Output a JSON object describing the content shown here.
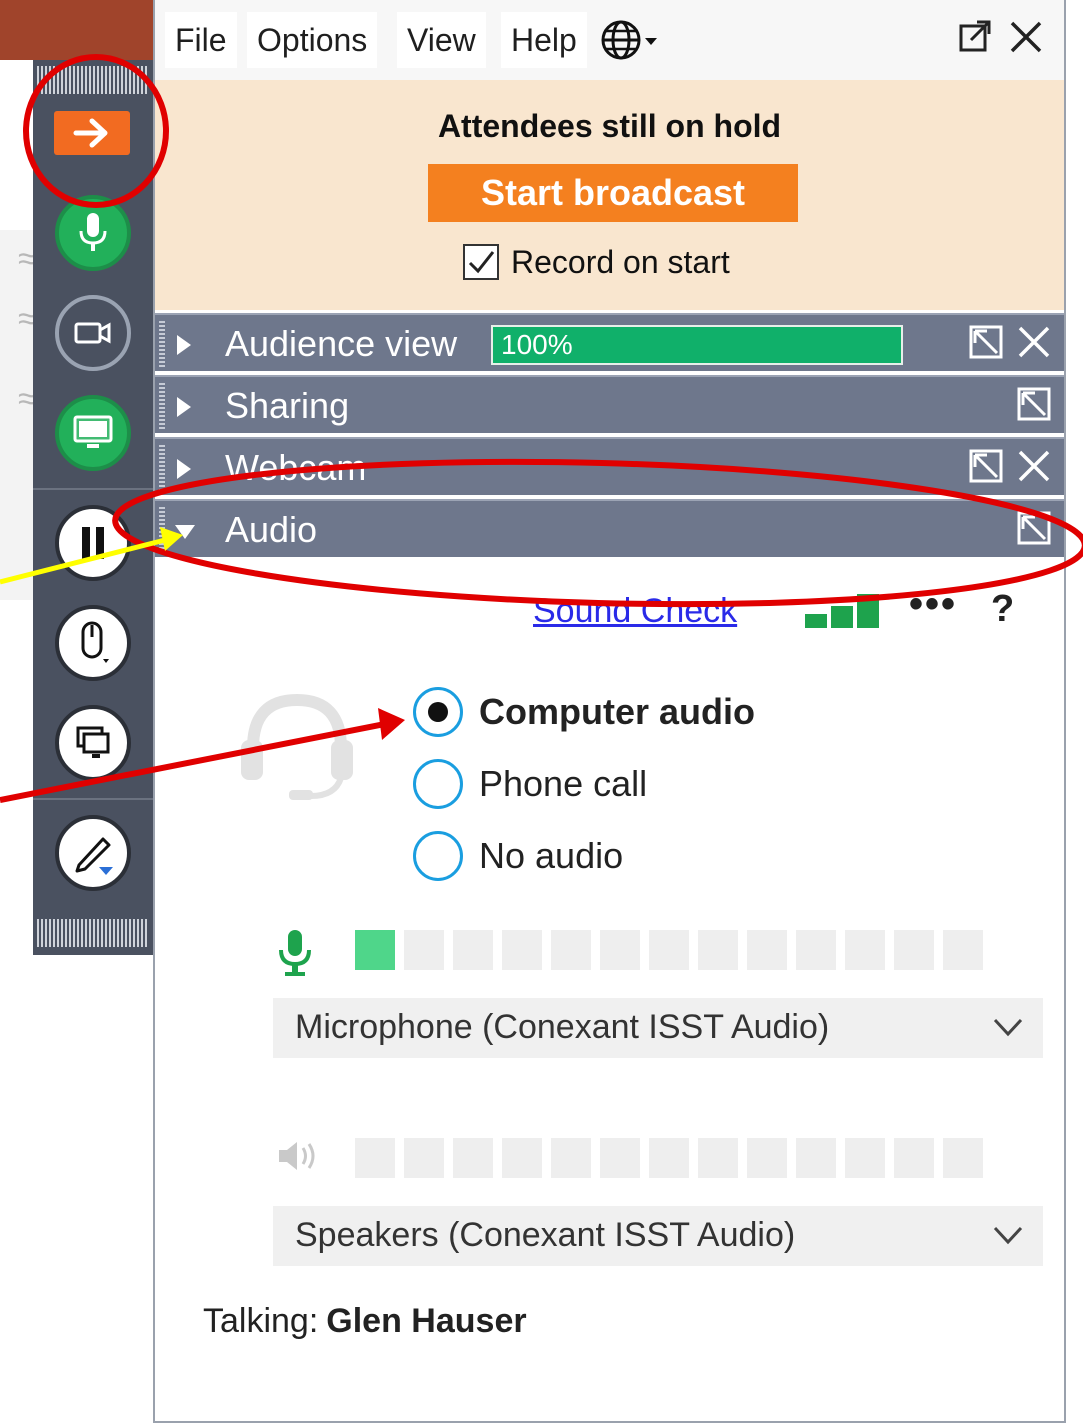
{
  "menu": {
    "file": "File",
    "options": "Options",
    "view": "View",
    "help": "Help"
  },
  "window": {
    "popout_icon": "popout-icon",
    "close_icon": "close-icon"
  },
  "hold": {
    "title": "Attendees still on hold",
    "start_broadcast": "Start broadcast",
    "record_on_start": "Record on start",
    "record_checked": true
  },
  "sections": {
    "audience_view": "Audience view",
    "audience_view_percent": "100%",
    "sharing": "Sharing",
    "webcam": "Webcam",
    "audio": "Audio"
  },
  "audio": {
    "sound_check": "Sound Check",
    "more_label": "•••",
    "help_label": "?",
    "options": [
      {
        "label": "Computer audio",
        "selected": true
      },
      {
        "label": "Phone call",
        "selected": false
      },
      {
        "label": "No audio",
        "selected": false
      }
    ],
    "microphone_device": "Microphone (Conexant ISST Audio)",
    "speaker_device": "Speakers (Conexant ISST Audio)",
    "mic_level_segments_lit": 1,
    "meter_segments_total": 13,
    "talking_label": "Talking:",
    "talking_name": "Glen Hauser"
  },
  "toolbar": {
    "icons": [
      "arrow-right-icon",
      "microphone-icon",
      "webcam-icon",
      "screen-share-icon",
      "pause-icon",
      "mouse-icon",
      "screens-icon",
      "pen-icon"
    ]
  },
  "colors": {
    "accent_orange": "#f4801f",
    "section_bar": "#6e778c",
    "green": "#22b05a",
    "annotation_red": "#e00000",
    "annotation_yellow": "#ffff00"
  }
}
